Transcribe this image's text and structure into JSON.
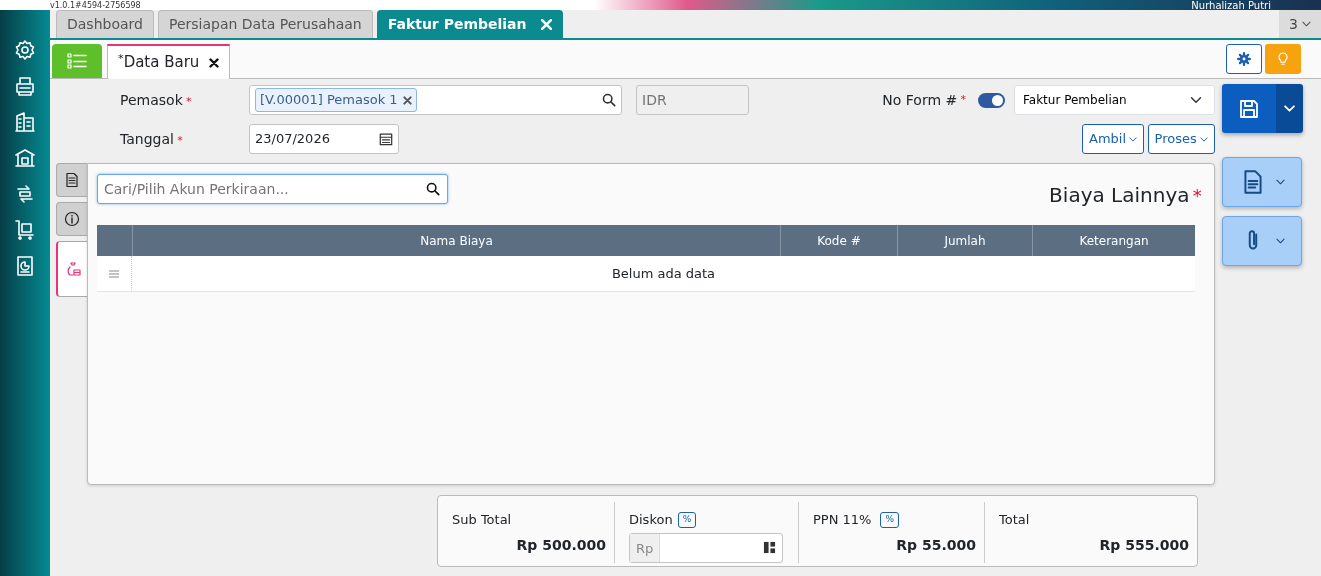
{
  "header": {
    "version": "v1.0.1#4594-2756598",
    "user_name": "Nurhalizah Putri"
  },
  "top_tabs": [
    {
      "label": "Dashboard",
      "selected": false,
      "closable": false
    },
    {
      "label": "Persiapan Data Perusahaan",
      "selected": false,
      "closable": false
    },
    {
      "label": "Faktur Pembelian",
      "selected": true,
      "closable": true
    }
  ],
  "tab_count": "3",
  "sub_tabs": [
    {
      "label": "Data Baru",
      "marker": "*",
      "selected": true
    }
  ],
  "form": {
    "supplier": {
      "label": "Pemasok",
      "required_mark": "*",
      "tag": "[V.00001] Pemasok 1"
    },
    "currency": {
      "placeholder": "IDR"
    },
    "form_no": {
      "label": "No Form #",
      "required_mark": "*",
      "auto": true,
      "select": "Faktur Pembelian"
    },
    "date": {
      "label": "Tanggal",
      "required_mark": "*",
      "value": "23/07/2026"
    },
    "buttons": [
      "Ambil",
      "Proses"
    ]
  },
  "side_tabs": [
    {
      "kind": "document",
      "selected": false
    },
    {
      "kind": "info",
      "selected": false
    },
    {
      "kind": "cost",
      "selected": true
    }
  ],
  "search": {
    "placeholder": "Cari/Pilih Akun Perkiraan..."
  },
  "section": {
    "title": "Biaya Lainnya",
    "required_mark": "*"
  },
  "table": {
    "columns": [
      "Nama Biaya",
      "Kode #",
      "Jumlah",
      "Keterangan"
    ],
    "empty_text": "Belum ada data"
  },
  "totals": [
    {
      "kind": "value",
      "label": "Sub Total",
      "value": "Rp 500.000"
    },
    {
      "kind": "input",
      "label": "Diskon",
      "badge": "%",
      "prefix": "Rp"
    },
    {
      "kind": "value",
      "label": "PPN 11%",
      "badge": "%",
      "value": "Rp 55.000"
    },
    {
      "kind": "value",
      "label": "Total",
      "value": "Rp 555.000"
    }
  ]
}
